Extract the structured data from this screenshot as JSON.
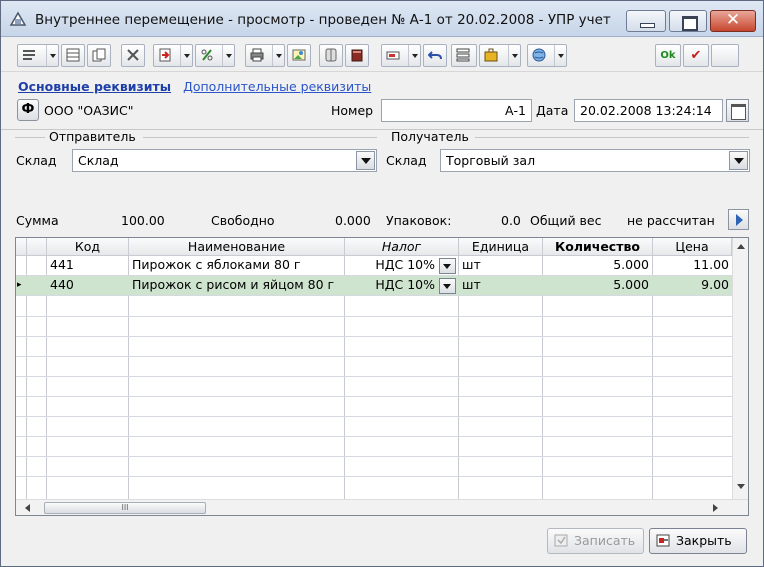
{
  "window": {
    "title": "Внутреннее перемещение - просмотр - проведен № А-1 от 20.02.2008 - УПР учет",
    "close_glyph": "✕"
  },
  "toolbar": {
    "ok_label": "Ok",
    "confirm_glyph": "✔"
  },
  "tabs": {
    "main": "Основные реквизиты",
    "additional": "Дополнительные реквизиты"
  },
  "header": {
    "org_button": "Ф",
    "org_name": "ООО \"ОАЗИС\"",
    "number_label": "Номер",
    "number_value": "А-1",
    "date_label": "Дата",
    "date_value": "20.02.2008 13:24:14"
  },
  "sender": {
    "title": "Отправитель",
    "warehouse_label": "Склад",
    "warehouse_value": "Склад"
  },
  "receiver": {
    "title": "Получатель",
    "warehouse_label": "Склад",
    "warehouse_value": "Торговый зал"
  },
  "totals": {
    "sum_label": "Сумма",
    "sum_value": "100.00",
    "free_label": "Свободно",
    "free_value": "0.000",
    "packages_label": "Упаковок:",
    "packages_value": "0.0",
    "weight_label": "Общий вес",
    "weight_value": "не рассчитан"
  },
  "grid": {
    "columns": {
      "code": "Код",
      "name": "Наименование",
      "tax": "Налог",
      "unit": "Единица",
      "quantity": "Количество",
      "price": "Цена"
    },
    "rows": [
      {
        "code": "441",
        "name": "Пирожок с яблоками 80 г",
        "tax": "НДС 10%",
        "unit": "шт",
        "quantity": "5.000",
        "price": "11.00"
      },
      {
        "code": "440",
        "name": "Пирожок с рисом и яйцом 80 г",
        "tax": "НДС 10%",
        "unit": "шт",
        "quantity": "5.000",
        "price": "9.00"
      }
    ],
    "selected_row": 1,
    "row_marker": "▸",
    "scroll_thumb_glyph": "III"
  },
  "footer": {
    "save_label": "Записать",
    "close_label": "Закрыть"
  },
  "colors": {
    "selected_row": "#cfe4cf",
    "link": "#2b55c8",
    "close_button": "#c7462f"
  }
}
